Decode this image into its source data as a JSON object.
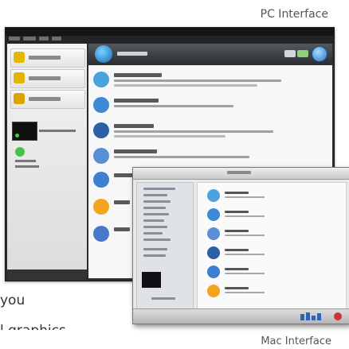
{
  "captions": {
    "pc": "PC Interface",
    "mac": "Mac Interface"
  },
  "body_text": {
    "line1": "you",
    "line2": "l graphics"
  },
  "pc_window": {
    "sidebar_items": [
      {
        "icon": "data-disc-icon",
        "color": "#e6b800"
      },
      {
        "icon": "audio-disc-icon",
        "color": "#e3b400"
      },
      {
        "icon": "video-disc-icon",
        "color": "#d9a400"
      }
    ],
    "projects": [
      {
        "icon": "data-project-icon",
        "color": "#4aa3e0"
      },
      {
        "icon": "audio-project-icon",
        "color": "#3b8ad8"
      },
      {
        "icon": "copy-project-icon",
        "color": "#2c5fa8"
      },
      {
        "icon": "video-project-icon",
        "color": "#5a8ed8"
      },
      {
        "icon": "disc-image-projects-icon",
        "color": "#3f7fd1"
      },
      {
        "icon": "photo-project-icon",
        "color": "#f2a51c"
      },
      {
        "icon": "utility-project-icon",
        "color": "#4a78c8"
      }
    ]
  },
  "mac_window": {
    "projects": [
      {
        "icon": "data-project-icon",
        "color": "#4aa3e0"
      },
      {
        "icon": "audio-project-icon",
        "color": "#3b8ad8"
      },
      {
        "icon": "video-project-icon",
        "color": "#5a8ed8"
      },
      {
        "icon": "copy-project-icon",
        "color": "#2c5fa8"
      },
      {
        "icon": "image-project-icon",
        "color": "#3f7fd1"
      },
      {
        "icon": "photo-project-icon",
        "color": "#f2a51c"
      }
    ]
  }
}
